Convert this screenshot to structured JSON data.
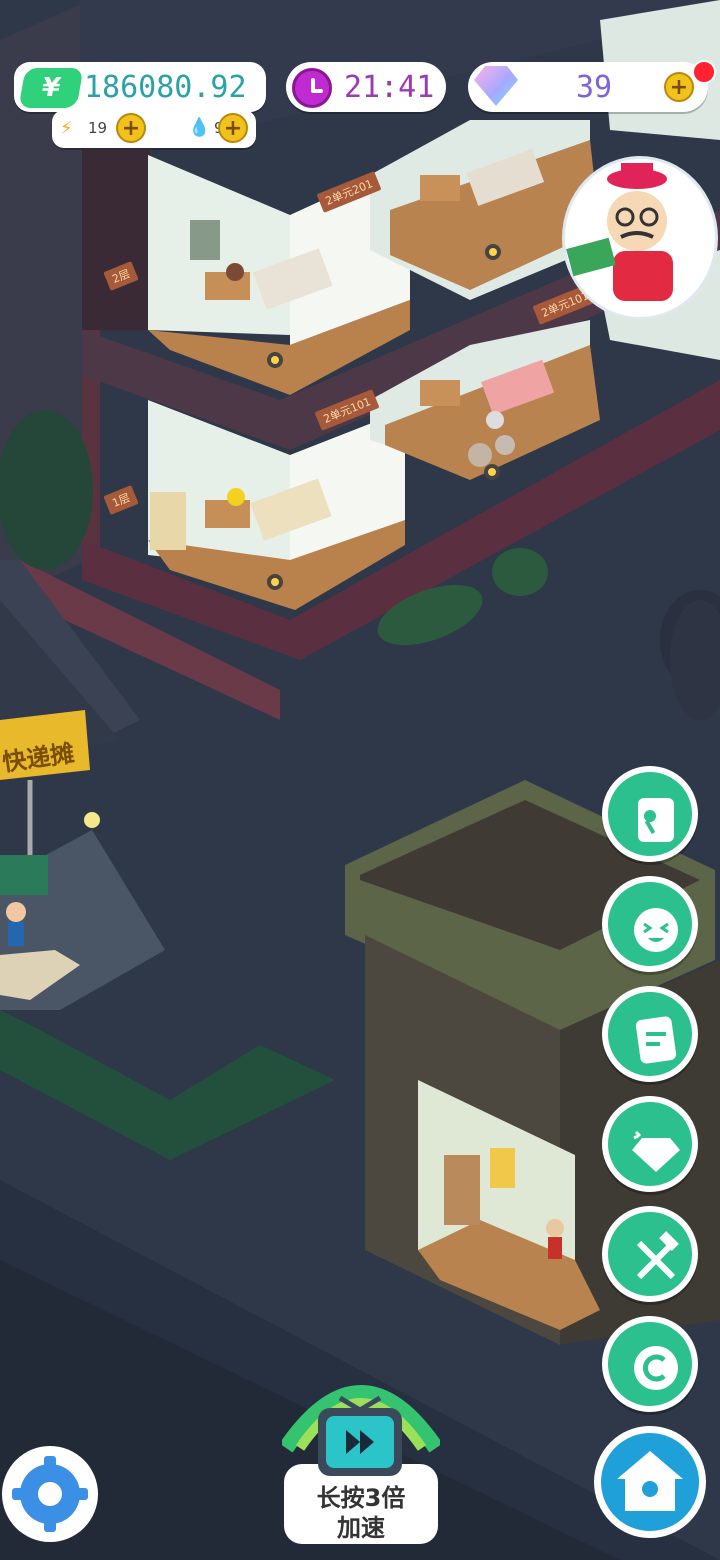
{
  "hud": {
    "money": "186080.92",
    "money_icon_symbol": "¥",
    "energy": "19",
    "water": "9",
    "time": "21:41",
    "gems": "39",
    "plus_symbol": "+"
  },
  "rooms": {
    "label_201": "2单元201",
    "label_101": "2单元101",
    "label_floor2": "2层",
    "label_floor1": "1层",
    "label_top_right": "2单元101"
  },
  "street": {
    "stall_sign": "快递摊"
  },
  "speed_button": {
    "line1": "长按3倍",
    "line2": "加速"
  },
  "side_buttons": [
    {
      "name": "tools-icon"
    },
    {
      "name": "emoji-icon"
    },
    {
      "name": "notes-icon"
    },
    {
      "name": "gem-shop-icon"
    },
    {
      "name": "wrench-hammer-icon"
    },
    {
      "name": "copyright-pin-icon"
    }
  ],
  "colors": {
    "accent": "#2bc08d",
    "money_text": "#2aa2a8",
    "time_text": "#9a3ab5",
    "gem_text": "#7e63d9"
  }
}
